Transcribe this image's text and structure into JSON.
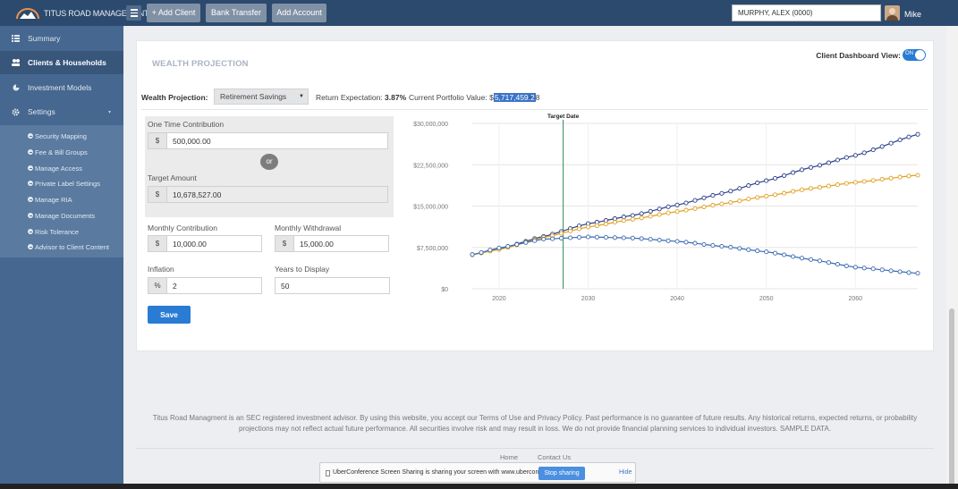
{
  "topbar": {
    "logo_text": "TITUS ROAD MANAGEMENT",
    "buttons": {
      "add_client": "+ Add Client",
      "bank_transfer": "Bank Transfer",
      "add_account": "Add Account"
    },
    "client_search_value": "MURPHY, ALEX (0000)",
    "user_name": "Mike"
  },
  "sidebar": {
    "items": [
      {
        "label": "Summary",
        "icon": "list-icon"
      },
      {
        "label": "Clients & Households",
        "icon": "users-icon"
      },
      {
        "label": "Investment Models",
        "icon": "pie-icon"
      },
      {
        "label": "Settings",
        "icon": "gear-icon"
      }
    ],
    "settings_sub": [
      "Security Mapping",
      "Fee & Bill Groups",
      "Manage Access",
      "Private Label Settings",
      "Manage RIA",
      "Manage Documents",
      "Risk Tolerance",
      "Advisor to Client Content"
    ]
  },
  "panel": {
    "title": "WEALTH PROJECTION",
    "dashboard_view_label": "Client Dashboard View:",
    "dashboard_toggle": "ON",
    "wp_label": "Wealth Projection:",
    "wp_select": "Retirement Savings",
    "return_label": "Return Expectation:",
    "return_value": "3.87%",
    "portfolio_label": "Current Portfolio Value:",
    "portfolio_prefix": "$",
    "portfolio_value_highlight": "5,717,459.2",
    "portfolio_value_rest": "8"
  },
  "form": {
    "one_time_label": "One Time Contribution",
    "one_time_value": "500,000.00",
    "or_label": "or",
    "target_label": "Target Amount",
    "target_value": "10,678,527.00",
    "monthly_contrib_label": "Monthly Contribution",
    "monthly_contrib_value": "10,000.00",
    "monthly_withdraw_label": "Monthly Withdrawal",
    "monthly_withdraw_value": "15,000.00",
    "inflation_label": "Inflation",
    "inflation_value": "2",
    "years_label": "Years to Display",
    "years_value": "50",
    "dollar": "$",
    "percent": "%",
    "save_label": "Save"
  },
  "chart_data": {
    "type": "line",
    "title": "",
    "xlabel": "",
    "ylabel": "",
    "xlim": [
      2017,
      2067
    ],
    "ylim": [
      0,
      30000000
    ],
    "y_ticks": [
      0,
      7500000,
      15000000,
      22500000,
      30000000
    ],
    "y_tick_labels": [
      "$0",
      "$7,500,000",
      "$15,000,000",
      "$22,500,000",
      "$30,000,000"
    ],
    "x_ticks": [
      2020,
      2030,
      2040,
      2050,
      2060
    ],
    "x_tick_labels": [
      "2020",
      "2030",
      "2040",
      "2050",
      "2060"
    ],
    "grid": true,
    "annotations": [
      {
        "type": "vertical_line",
        "x": 2027.2,
        "label": "Target Date",
        "color": "#2e8b57"
      }
    ],
    "series": [
      {
        "color": "#2c3e8a",
        "x": [
          2017,
          2020,
          2025,
          2030,
          2035,
          2040,
          2045,
          2050,
          2055,
          2060,
          2067
        ],
        "values": [
          6200000,
          7200000,
          9500000,
          11800000,
          13300000,
          15200000,
          17300000,
          19600000,
          22000000,
          24200000,
          28000000
        ]
      },
      {
        "color": "#e0a020",
        "x": [
          2017,
          2020,
          2025,
          2030,
          2035,
          2040,
          2045,
          2050,
          2055,
          2060,
          2067
        ],
        "values": [
          6200000,
          7100000,
          9300000,
          11200000,
          12600000,
          14000000,
          15400000,
          16800000,
          18200000,
          19300000,
          20600000
        ]
      },
      {
        "color": "#3a6ab0",
        "x": [
          2017,
          2020,
          2025,
          2030,
          2035,
          2040,
          2045,
          2050,
          2055,
          2060,
          2067
        ],
        "values": [
          6200000,
          7400000,
          9000000,
          9400000,
          9200000,
          8600000,
          7700000,
          6700000,
          5300000,
          3900000,
          2800000
        ]
      }
    ]
  },
  "footer": {
    "disclaimer": "Titus Road Managment is an SEC registered investment advisor. By using this website, you accept our Terms of Use and Privacy Policy. Past performance is no guarantee of future results. Any historical returns, expected returns, or probability projections may not reflect actual future performance. All securities involve risk and may result in loss. We do not provide financial planning services to individual investors. SAMPLE DATA.",
    "home": "Home",
    "contact": "Contact Us"
  },
  "share_bar": {
    "text": "UberConference Screen Sharing is sharing your screen with www.uberconference.com.",
    "stop": "Stop sharing",
    "hide": "Hide"
  }
}
